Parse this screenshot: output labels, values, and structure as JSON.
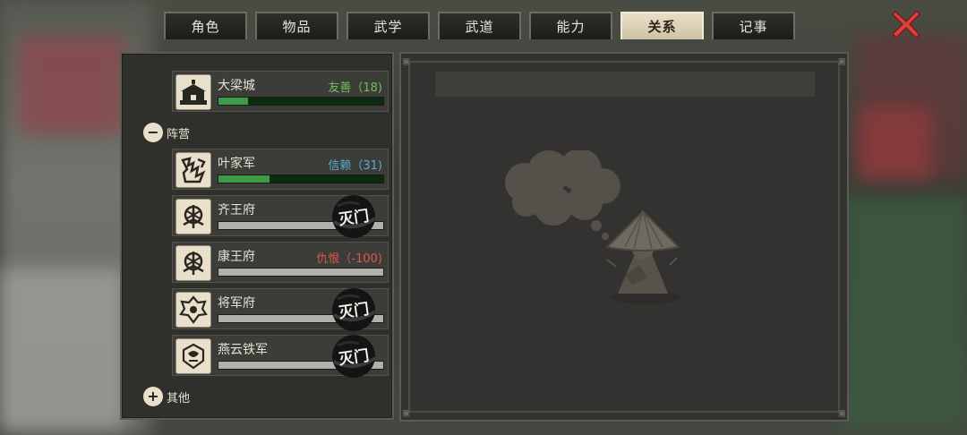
{
  "tabs": [
    {
      "label": "角色",
      "active": false
    },
    {
      "label": "物品",
      "active": false
    },
    {
      "label": "武学",
      "active": false
    },
    {
      "label": "武道",
      "active": false
    },
    {
      "label": "能力",
      "active": false
    },
    {
      "label": "关系",
      "active": true
    },
    {
      "label": "记事",
      "active": false
    }
  ],
  "close_icon": "close-x-icon",
  "colors": {
    "friendly": "#6fbf5e",
    "trust": "#59a9d6",
    "hatred": "#d85a4c",
    "accent": "#3f9a48"
  },
  "relations": {
    "top_entry": {
      "name": "大梁城",
      "status": "友善（18)",
      "level": 18,
      "bar_fraction": 0.18,
      "icon": "city-gate-icon"
    },
    "camp_section": {
      "label": "阵营",
      "toggle_icon": "minus-icon",
      "entries": [
        {
          "name": "叶家军",
          "status": "信赖（31)",
          "level": 31,
          "bar_fraction": 0.31,
          "icon": "ye-army-emblem-icon",
          "destroyed": false
        },
        {
          "name": "齐王府",
          "status": "",
          "bar_fraction": 0,
          "icon": "qi-mansion-emblem-icon",
          "destroyed": true,
          "stamp": "灭门"
        },
        {
          "name": "康王府",
          "status": "仇恨（-100)",
          "level": -100,
          "bar_fraction": 0,
          "icon": "kang-mansion-emblem-icon",
          "destroyed": false
        },
        {
          "name": "将军府",
          "status": "",
          "bar_fraction": 0,
          "icon": "general-mansion-emblem-icon",
          "destroyed": true,
          "stamp": "灭门"
        },
        {
          "name": "燕云铁军",
          "status": "",
          "bar_fraction": 0,
          "icon": "yanyun-army-emblem-icon",
          "destroyed": true,
          "stamp": "灭门"
        }
      ]
    },
    "other_section": {
      "label": "其他",
      "toggle_icon": "plus-icon"
    }
  },
  "detail": {
    "character_icon": "straw-hat-wanderer-icon",
    "thought_icon": "thought-bubble-icon"
  }
}
